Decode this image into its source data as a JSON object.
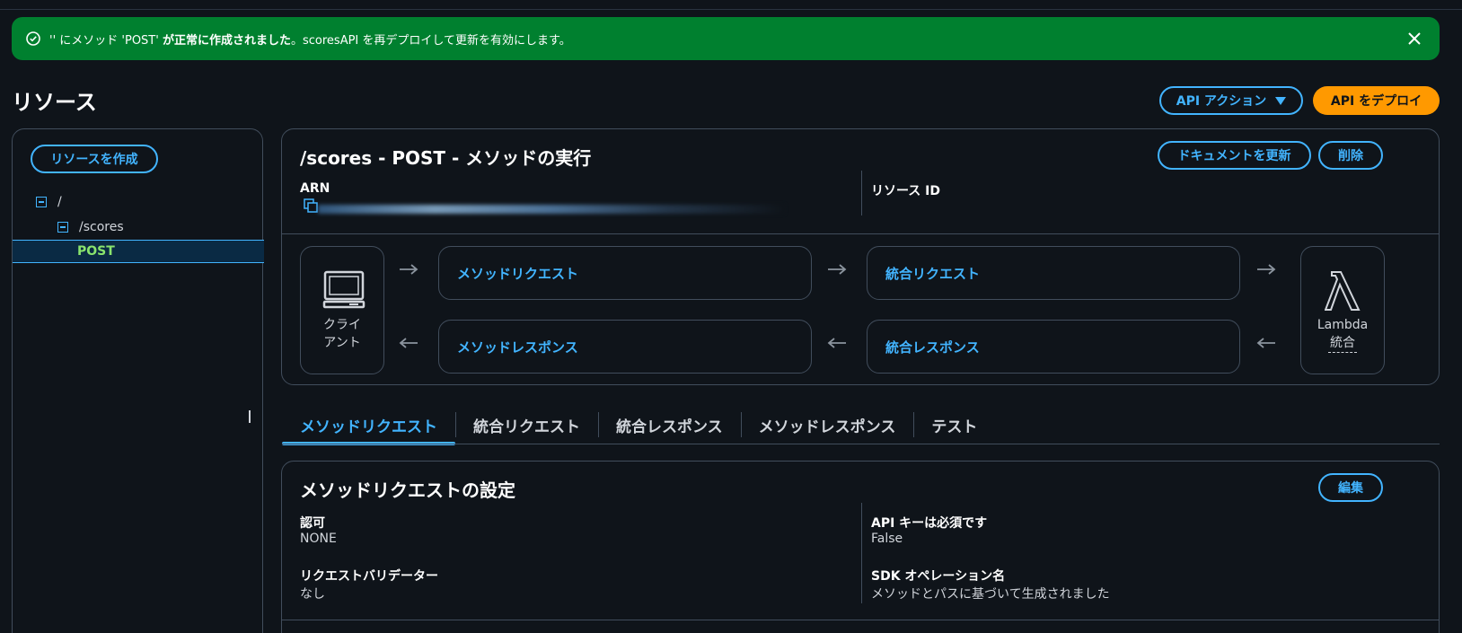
{
  "flash": {
    "pre": "'' にメソッド 'POST' ",
    "bold": "が正常に作成されました",
    "post": "。scoresAPI を再デプロイして更新を有効にします。",
    "icons": {
      "status": "check-circle-icon",
      "close": "close-icon"
    }
  },
  "header": {
    "title": "リソース",
    "api_actions": "API アクション",
    "deploy": "API をデプロイ"
  },
  "sidebar": {
    "create": "リソースを作成",
    "tree": [
      "/",
      "/scores",
      "POST"
    ]
  },
  "method": {
    "title": "/scores - POST - メソッドの実行",
    "update_docs": "ドキュメントを更新",
    "delete": "削除",
    "arn_label": "ARN",
    "resource_id_label": "リソース ID"
  },
  "flow": {
    "client_line1": "クライ",
    "client_line2": "アント",
    "method_request": "メソッドリクエスト",
    "integration_request": "統合リクエスト",
    "method_response": "メソッドレスポンス",
    "integration_response": "統合レスポンス",
    "lambda_line1": "Lambda",
    "lambda_line2": "統合"
  },
  "tabs": [
    "メソッドリクエスト",
    "統合リクエスト",
    "統合レスポンス",
    "メソッドレスポンス",
    "テスト"
  ],
  "settings": {
    "title": "メソッドリクエストの設定",
    "edit": "編集",
    "auth_label": "認可",
    "auth_value": "NONE",
    "validator_label": "リクエストバリデーター",
    "validator_value": "なし",
    "apikey_label": "API キーは必須です",
    "apikey_value": "False",
    "sdk_label": "SDK オペレーション名",
    "sdk_value": "メソッドとパスに基づいて生成されました"
  },
  "colors": {
    "accent": "#42b4ff",
    "success": "#00802f",
    "primary": "#ff9900",
    "method": "#89e36d"
  }
}
